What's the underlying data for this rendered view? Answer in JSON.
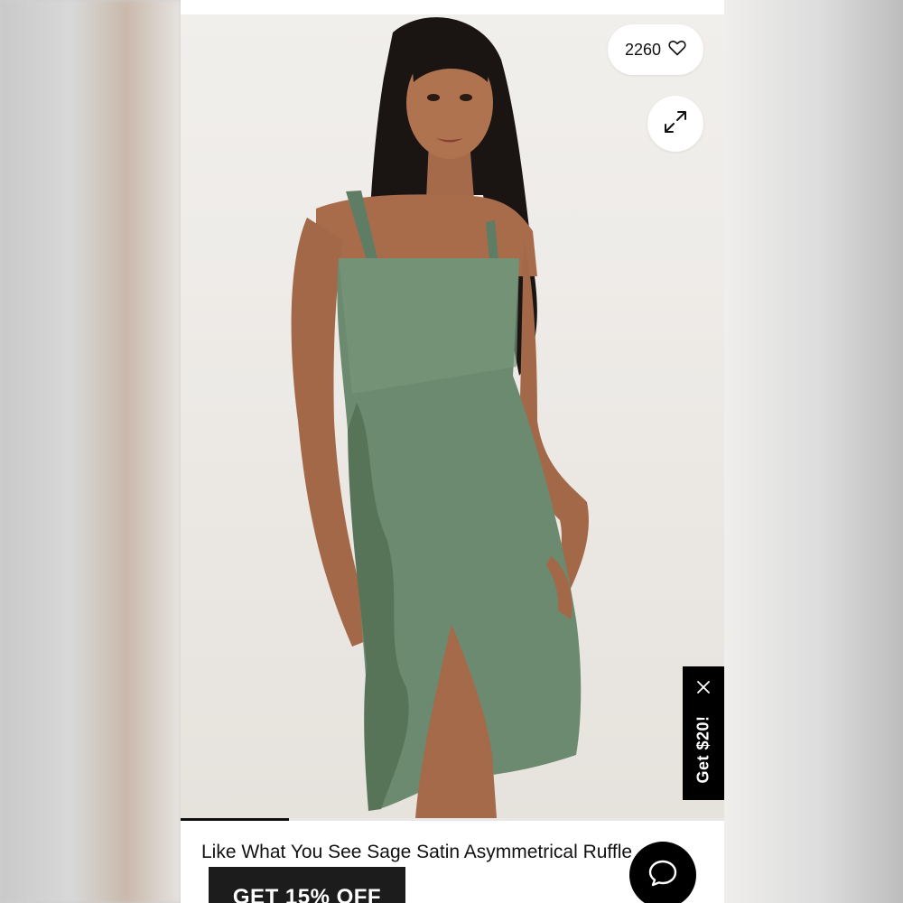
{
  "product": {
    "title": "Like What You See Sage Satin Asymmetrical Ruffle",
    "image_alt": "Model wearing sage green satin asymmetrical ruffle dress",
    "colors": {
      "dress": "#6b8a70",
      "background": "#ece9e5"
    }
  },
  "favorites": {
    "count": "2260",
    "icon": "heart-icon"
  },
  "expand": {
    "icon": "expand-arrows-icon"
  },
  "promo_tab": {
    "label": "Get $20!",
    "close_icon": "close-icon"
  },
  "discount_banner": {
    "label": "GET 15% OFF"
  },
  "chat": {
    "icon": "chat-bubble-icon"
  },
  "gallery": {
    "progress": 0.2
  }
}
